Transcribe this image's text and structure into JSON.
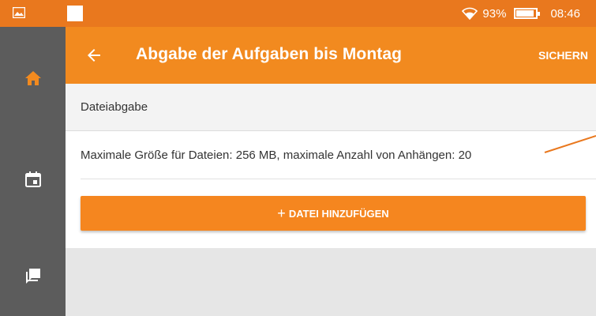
{
  "status_bar": {
    "battery": "93%",
    "time": "08:46",
    "icons": [
      "image-icon",
      "notification-square-icon",
      "wifi-icon",
      "battery-icon"
    ]
  },
  "side_nav": {
    "items": [
      {
        "icon": "home-icon",
        "active": true
      },
      {
        "icon": "calendar-icon",
        "active": false
      },
      {
        "icon": "chat-icon",
        "active": false
      }
    ],
    "active_color": "#f28a1f"
  },
  "app_bar": {
    "title": "Abgabe der Aufgaben bis Montag",
    "save_label": "SICHERN",
    "back_icon": "arrow-back-icon",
    "color": "#f28a1f"
  },
  "submission": {
    "section_title": "Dateiabgabe",
    "info": "Maximale Größe für Dateien: 256 MB, maximale Anzahl von Anhängen: 20",
    "add_button_plus": "+",
    "add_button_label": "DATEI HINZUFÜGEN",
    "button_color": "#f5861f"
  }
}
